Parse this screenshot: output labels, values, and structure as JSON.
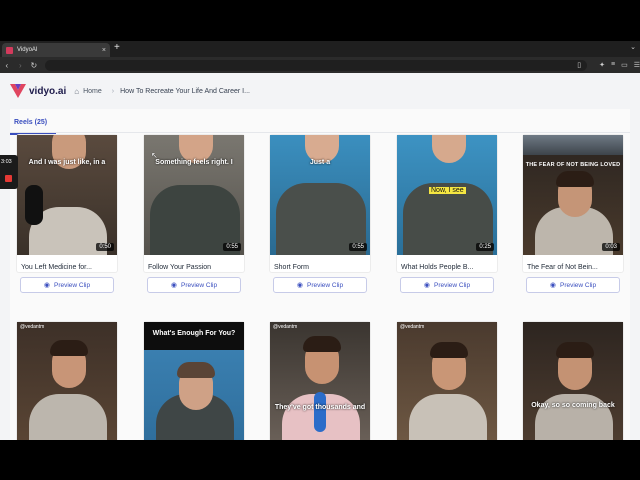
{
  "browser": {
    "tab_title": "VidyoAI",
    "new_tab": "+",
    "close": "×"
  },
  "app": {
    "logo_text": "vidyo.ai",
    "breadcrumb_home": "Home",
    "breadcrumb_current": "How To Recreate Your Life And Career I...",
    "reels_tab": "Reels (25)",
    "brand_color": "#3b4fbf"
  },
  "recorder": {
    "time": "3:03"
  },
  "clips": [
    {
      "title": "You Left Medicine for...",
      "duration": "0:50",
      "caption": "And I was just like, in a",
      "button": "Preview Clip"
    },
    {
      "title": "Follow Your Passion",
      "duration": "0:55",
      "caption": "Something feels right. I",
      "button": "Preview Clip"
    },
    {
      "title": "Short Form",
      "duration": "0:55",
      "caption": "Just a",
      "button": "Preview Clip"
    },
    {
      "title": "What Holds People B...",
      "duration": "0:25",
      "caption": "Now, I see",
      "button": "Preview Clip"
    },
    {
      "title": "The Fear of Not Bein...",
      "duration": "0:03",
      "caption": "THE FEAR OF NOT BEING LOVED",
      "button": "Preview Clip"
    }
  ],
  "second_row": [
    {
      "handle": "@vedantm",
      "banner": "",
      "caption": ""
    },
    {
      "handle": "",
      "banner": "What's Enough For You?",
      "caption": ""
    },
    {
      "handle": "@vedantm",
      "banner": "",
      "caption": "They've got thousands and"
    },
    {
      "handle": "@vedantm",
      "banner": "",
      "caption": ""
    },
    {
      "handle": "",
      "banner": "",
      "caption": "Okay, so so coming back"
    }
  ]
}
